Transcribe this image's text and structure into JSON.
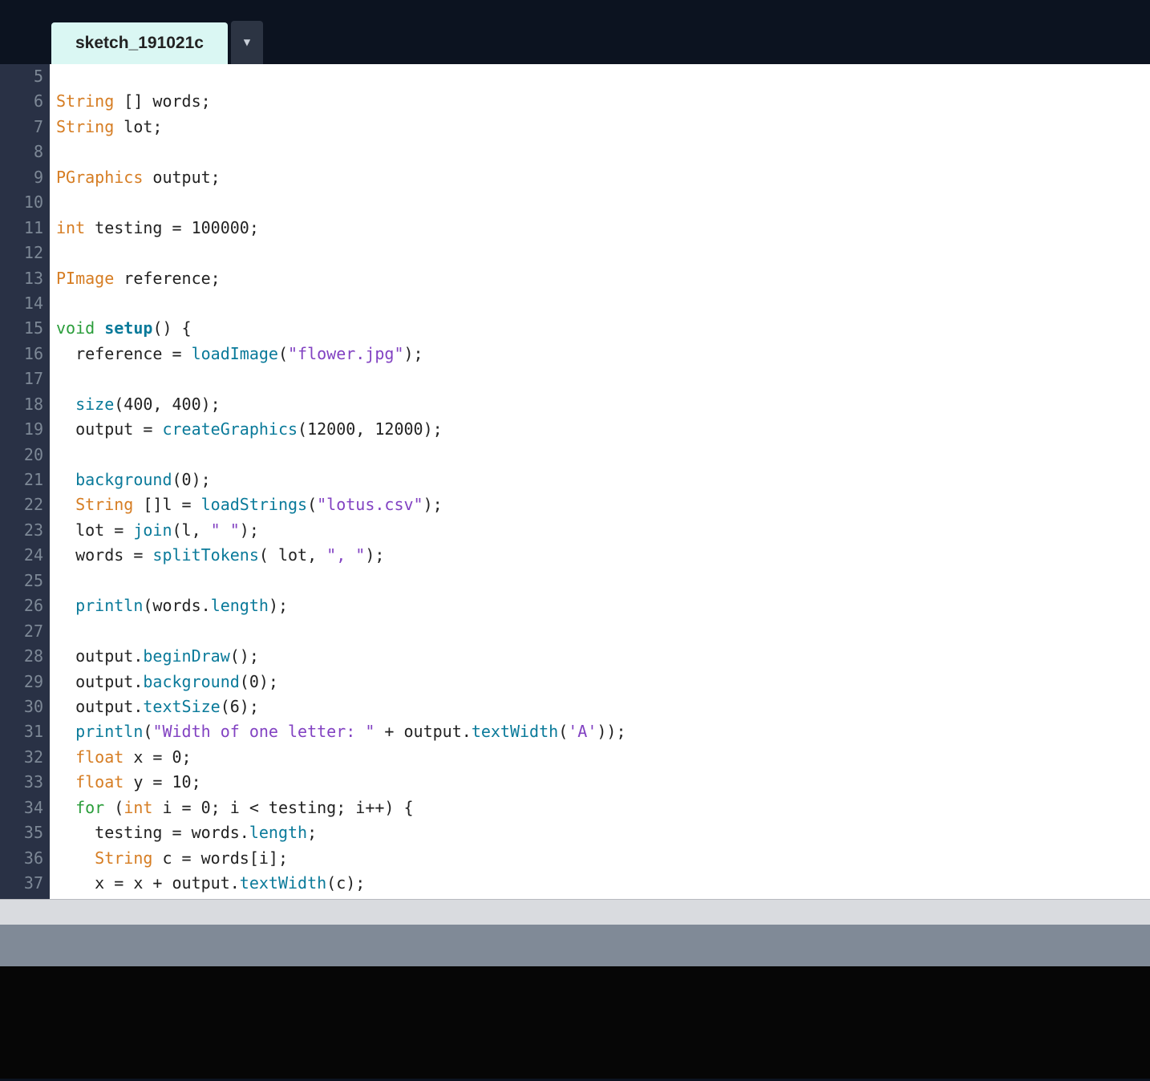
{
  "tab": {
    "name": "sketch_191021c",
    "dropdown_glyph": "▼"
  },
  "gutter": [
    "5",
    "6",
    "7",
    "8",
    "9",
    "10",
    "11",
    "12",
    "13",
    "14",
    "15",
    "16",
    "17",
    "18",
    "19",
    "20",
    "21",
    "22",
    "23",
    "24",
    "25",
    "26",
    "27",
    "28",
    "29",
    "30",
    "31",
    "32",
    "33",
    "34",
    "35",
    "36",
    "37"
  ],
  "code": [
    [],
    [
      {
        "c": "t-type",
        "t": "String"
      },
      {
        "c": "t-plain",
        "t": " [] words;"
      }
    ],
    [
      {
        "c": "t-type",
        "t": "String"
      },
      {
        "c": "t-plain",
        "t": " lot;"
      }
    ],
    [],
    [
      {
        "c": "t-type",
        "t": "PGraphics"
      },
      {
        "c": "t-plain",
        "t": " output;"
      }
    ],
    [],
    [
      {
        "c": "t-type",
        "t": "int"
      },
      {
        "c": "t-plain",
        "t": " testing = 100000;"
      }
    ],
    [],
    [
      {
        "c": "t-type",
        "t": "PImage"
      },
      {
        "c": "t-plain",
        "t": " reference;"
      }
    ],
    [],
    [
      {
        "c": "t-keyword",
        "t": "void"
      },
      {
        "c": "t-plain",
        "t": " "
      },
      {
        "c": "t-funcdef",
        "t": "setup"
      },
      {
        "c": "t-plain",
        "t": "() {"
      }
    ],
    [
      {
        "c": "t-plain",
        "t": "  reference = "
      },
      {
        "c": "t-func",
        "t": "loadImage"
      },
      {
        "c": "t-plain",
        "t": "("
      },
      {
        "c": "t-str",
        "t": "\"flower.jpg\""
      },
      {
        "c": "t-plain",
        "t": ");"
      }
    ],
    [],
    [
      {
        "c": "t-plain",
        "t": "  "
      },
      {
        "c": "t-func",
        "t": "size"
      },
      {
        "c": "t-plain",
        "t": "(400, 400);"
      }
    ],
    [
      {
        "c": "t-plain",
        "t": "  output = "
      },
      {
        "c": "t-func",
        "t": "createGraphics"
      },
      {
        "c": "t-plain",
        "t": "(12000, 12000);"
      }
    ],
    [],
    [
      {
        "c": "t-plain",
        "t": "  "
      },
      {
        "c": "t-func",
        "t": "background"
      },
      {
        "c": "t-plain",
        "t": "(0);"
      }
    ],
    [
      {
        "c": "t-plain",
        "t": "  "
      },
      {
        "c": "t-type",
        "t": "String"
      },
      {
        "c": "t-plain",
        "t": " []l = "
      },
      {
        "c": "t-func",
        "t": "loadStrings"
      },
      {
        "c": "t-plain",
        "t": "("
      },
      {
        "c": "t-str",
        "t": "\"lotus.csv\""
      },
      {
        "c": "t-plain",
        "t": ");"
      }
    ],
    [
      {
        "c": "t-plain",
        "t": "  lot = "
      },
      {
        "c": "t-func",
        "t": "join"
      },
      {
        "c": "t-plain",
        "t": "(l, "
      },
      {
        "c": "t-str",
        "t": "\" \""
      },
      {
        "c": "t-plain",
        "t": ");"
      }
    ],
    [
      {
        "c": "t-plain",
        "t": "  words = "
      },
      {
        "c": "t-func",
        "t": "splitTokens"
      },
      {
        "c": "t-plain",
        "t": "( lot, "
      },
      {
        "c": "t-str",
        "t": "\", \""
      },
      {
        "c": "t-plain",
        "t": ");"
      }
    ],
    [],
    [
      {
        "c": "t-plain",
        "t": "  "
      },
      {
        "c": "t-func",
        "t": "println"
      },
      {
        "c": "t-plain",
        "t": "(words."
      },
      {
        "c": "t-func",
        "t": "length"
      },
      {
        "c": "t-plain",
        "t": ");"
      }
    ],
    [],
    [
      {
        "c": "t-plain",
        "t": "  output."
      },
      {
        "c": "t-func",
        "t": "beginDraw"
      },
      {
        "c": "t-plain",
        "t": "();"
      }
    ],
    [
      {
        "c": "t-plain",
        "t": "  output."
      },
      {
        "c": "t-func",
        "t": "background"
      },
      {
        "c": "t-plain",
        "t": "(0);"
      }
    ],
    [
      {
        "c": "t-plain",
        "t": "  output."
      },
      {
        "c": "t-func",
        "t": "textSize"
      },
      {
        "c": "t-plain",
        "t": "(6);"
      }
    ],
    [
      {
        "c": "t-plain",
        "t": "  "
      },
      {
        "c": "t-func",
        "t": "println"
      },
      {
        "c": "t-plain",
        "t": "("
      },
      {
        "c": "t-str",
        "t": "\"Width of one letter: \""
      },
      {
        "c": "t-plain",
        "t": " + output."
      },
      {
        "c": "t-func",
        "t": "textWidth"
      },
      {
        "c": "t-plain",
        "t": "("
      },
      {
        "c": "t-str",
        "t": "'A'"
      },
      {
        "c": "t-plain",
        "t": "));"
      }
    ],
    [
      {
        "c": "t-plain",
        "t": "  "
      },
      {
        "c": "t-type",
        "t": "float"
      },
      {
        "c": "t-plain",
        "t": " x = 0;"
      }
    ],
    [
      {
        "c": "t-plain",
        "t": "  "
      },
      {
        "c": "t-type",
        "t": "float"
      },
      {
        "c": "t-plain",
        "t": " y = 10;"
      }
    ],
    [
      {
        "c": "t-plain",
        "t": "  "
      },
      {
        "c": "t-keyword",
        "t": "for"
      },
      {
        "c": "t-plain",
        "t": " ("
      },
      {
        "c": "t-type",
        "t": "int"
      },
      {
        "c": "t-plain",
        "t": " i = 0; i < testing; i++) {"
      }
    ],
    [
      {
        "c": "t-plain",
        "t": "    testing = words."
      },
      {
        "c": "t-func",
        "t": "length"
      },
      {
        "c": "t-plain",
        "t": ";"
      }
    ],
    [
      {
        "c": "t-plain",
        "t": "    "
      },
      {
        "c": "t-type",
        "t": "String"
      },
      {
        "c": "t-plain",
        "t": " c = words[i];"
      }
    ],
    [
      {
        "c": "t-plain",
        "t": "    x = x + output."
      },
      {
        "c": "t-func",
        "t": "textWidth"
      },
      {
        "c": "t-plain",
        "t": "(c);"
      }
    ]
  ]
}
